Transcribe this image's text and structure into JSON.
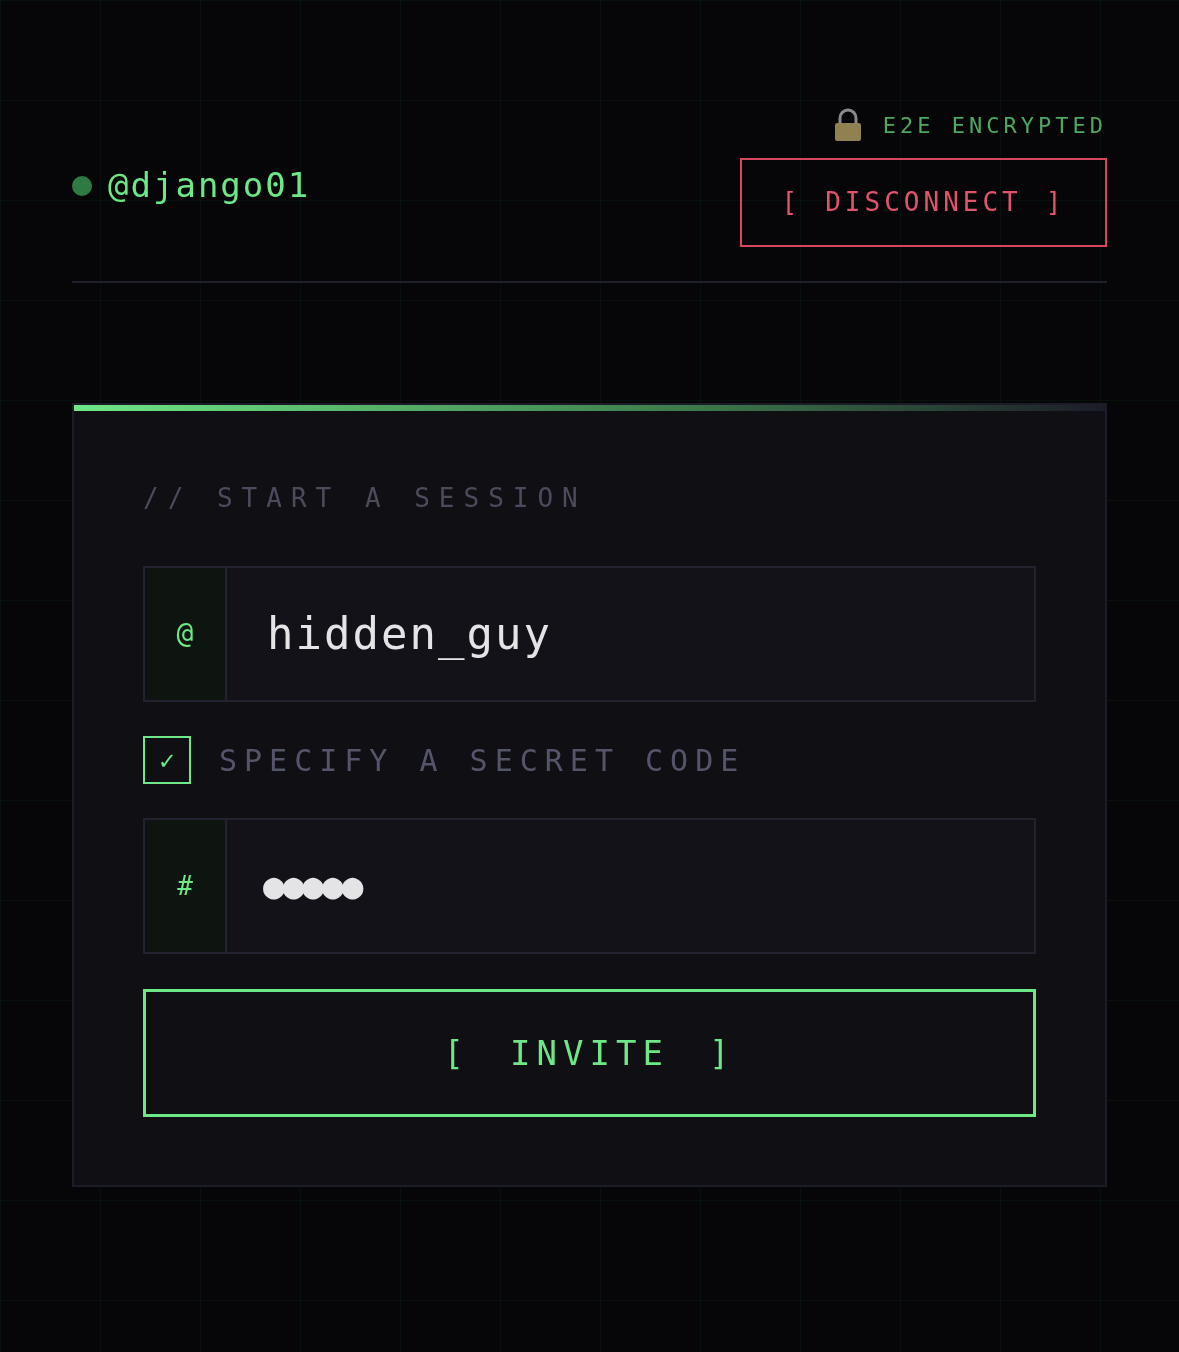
{
  "header": {
    "user": {
      "handle": "@django01",
      "online": true
    },
    "encryption_label": "E2E ENCRYPTED",
    "disconnect_button": {
      "bracket_left": "[",
      "label": "DISCONNECT",
      "bracket_right": "]"
    }
  },
  "session": {
    "title": "// START A SESSION",
    "username_field": {
      "prefix": "@",
      "value": "hidden_guy"
    },
    "secret_code": {
      "label": "SPECIFY A SECRET CODE",
      "checked": true,
      "mark": "✓"
    },
    "code_field": {
      "prefix": "#",
      "value": "●●●●●"
    },
    "invite_button": {
      "bracket_left": "[",
      "label": "INVITE",
      "bracket_right": "]"
    }
  }
}
